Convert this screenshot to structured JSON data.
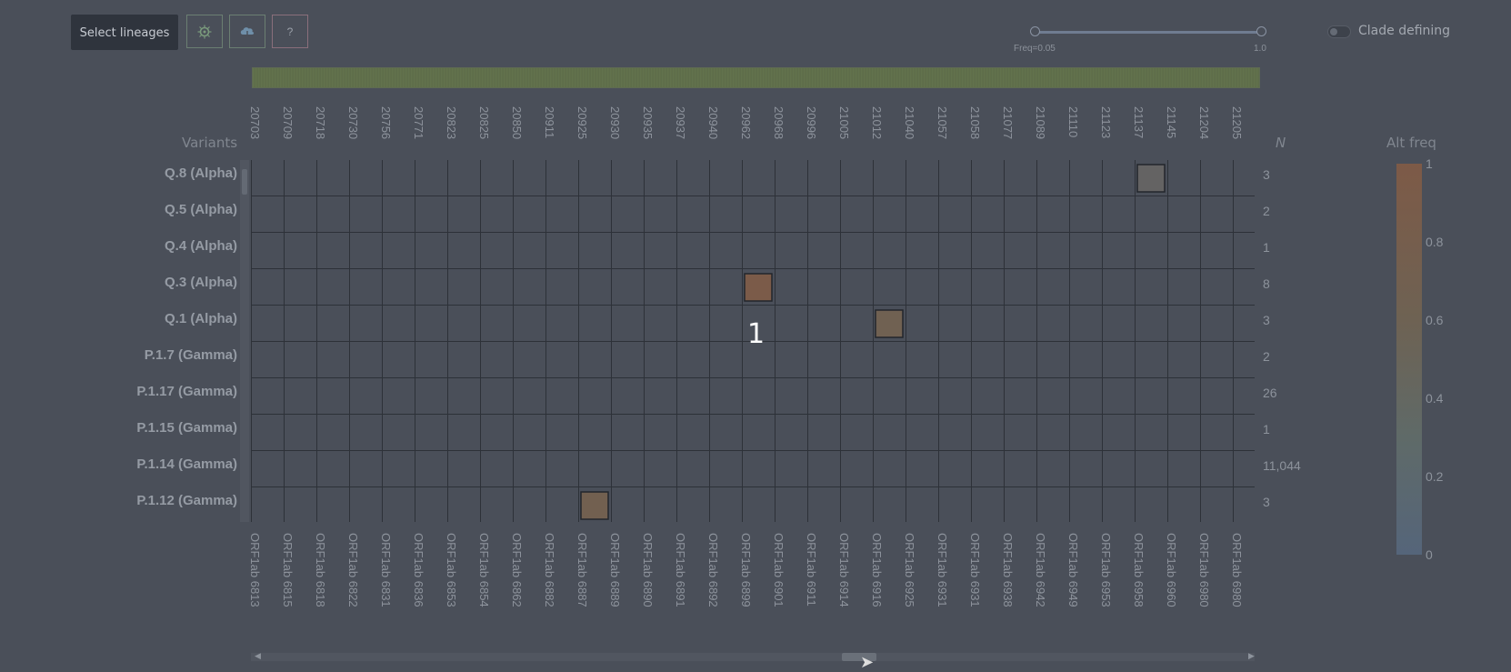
{
  "toolbar": {
    "select_label": "Select lineages",
    "icons": [
      "virus-icon",
      "cloud-download-icon",
      "help-icon"
    ],
    "help_label": "?"
  },
  "freq_slider": {
    "min_label": "Freq=0.05",
    "max_label": "1.0",
    "low": 0.05,
    "high": 1.0
  },
  "clade_toggle": {
    "label": "Clade defining",
    "on": false
  },
  "axis": {
    "variants_title": "Variants",
    "n_title": "N",
    "alt_freq_title": "Alt freq"
  },
  "positions": [
    "20703",
    "20709",
    "20718",
    "20730",
    "20756",
    "20771",
    "20823",
    "20825",
    "20850",
    "20911",
    "20925",
    "20930",
    "20935",
    "20937",
    "20940",
    "20962",
    "20968",
    "20996",
    "21005",
    "21012",
    "21040",
    "21057",
    "21058",
    "21077",
    "21089",
    "21110",
    "21123",
    "21137",
    "21145",
    "21204",
    "21205"
  ],
  "genes": [
    "ORF1ab 6813",
    "ORF1ab 6815",
    "ORF1ab 6818",
    "ORF1ab 6822",
    "ORF1ab 6831",
    "ORF1ab 6836",
    "ORF1ab 6853",
    "ORF1ab 6854",
    "ORF1ab 6862",
    "ORF1ab 6882",
    "ORF1ab 6887",
    "ORF1ab 6889",
    "ORF1ab 6890",
    "ORF1ab 6891",
    "ORF1ab 6892",
    "ORF1ab 6899",
    "ORF1ab 6901",
    "ORF1ab 6911",
    "ORF1ab 6914",
    "ORF1ab 6916",
    "ORF1ab 6925",
    "ORF1ab 6931",
    "ORF1ab 6931",
    "ORF1ab 6938",
    "ORF1ab 6942",
    "ORF1ab 6949",
    "ORF1ab 6953",
    "ORF1ab 6958",
    "ORF1ab 6960",
    "ORF1ab 6980",
    "ORF1ab 6980"
  ],
  "rows": [
    {
      "label": "Q.8 (Alpha)",
      "n": "3"
    },
    {
      "label": "Q.5 (Alpha)",
      "n": "2"
    },
    {
      "label": "Q.4 (Alpha)",
      "n": "1"
    },
    {
      "label": "Q.3 (Alpha)",
      "n": "8"
    },
    {
      "label": "Q.1 (Alpha)",
      "n": "3"
    },
    {
      "label": "P.1.7 (Gamma)",
      "n": "2"
    },
    {
      "label": "P.1.17 (Gamma)",
      "n": "26"
    },
    {
      "label": "P.1.15 (Gamma)",
      "n": "1"
    },
    {
      "label": "P.1.14 (Gamma)",
      "n": "11,044"
    },
    {
      "label": "P.1.12 (Gamma)",
      "n": "3"
    }
  ],
  "cells": [
    {
      "row": 0,
      "col": 27,
      "freq": 0.35
    },
    {
      "row": 3,
      "col": 15,
      "freq": 0.95
    },
    {
      "row": 4,
      "col": 19,
      "freq": 0.65
    },
    {
      "row": 9,
      "col": 10,
      "freq": 0.7
    }
  ],
  "colorbar": {
    "ticks": [
      "1",
      "0.8",
      "0.6",
      "0.4",
      "0.2",
      "0"
    ]
  },
  "overlay_number": "1"
}
